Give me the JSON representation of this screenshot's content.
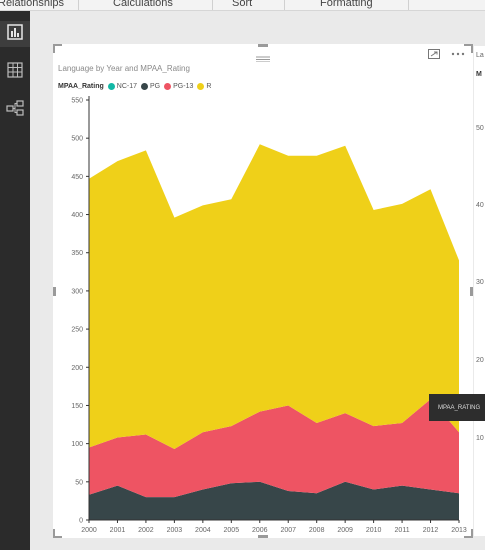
{
  "ribbon": {
    "tabs": [
      "Relationships",
      "Calculations",
      "Sort",
      "Formatting"
    ]
  },
  "sidebar": {
    "items": [
      {
        "name": "report-view",
        "icon": "bar-chart-icon",
        "active": true
      },
      {
        "name": "data-view",
        "icon": "table-icon",
        "active": false
      },
      {
        "name": "relationships-view",
        "icon": "relationship-icon",
        "active": false
      }
    ]
  },
  "visual": {
    "title": "Language by Year and MPAA_Rating",
    "legend_title": "MPAA_Rating",
    "tooltip_label": "MPAA_RATING"
  },
  "second_visual": {
    "title_fragment": "La",
    "legend_fragment": "M",
    "axis_fragments": [
      "50",
      "40",
      "30",
      "20",
      "10"
    ]
  },
  "colors": {
    "NC-17": "#13b8a6",
    "PG": "#374649",
    "PG-13": "#ee5463",
    "R": "#efd019",
    "axis": "#333333"
  },
  "chart_data": {
    "type": "area",
    "stacked": true,
    "title": "Language by Year and MPAA_Rating",
    "legend_title": "MPAA_Rating",
    "legend_position": "top-left",
    "x": [
      "2000",
      "2001",
      "2002",
      "2003",
      "2004",
      "2005",
      "2006",
      "2007",
      "2008",
      "2009",
      "2010",
      "2011",
      "2012",
      "2013"
    ],
    "series": [
      {
        "name": "NC-17",
        "values": [
          0,
          0,
          0,
          0,
          0,
          0,
          0,
          0,
          0,
          0,
          0,
          0,
          0,
          0
        ]
      },
      {
        "name": "PG",
        "values": [
          33,
          45,
          30,
          30,
          40,
          48,
          50,
          38,
          35,
          50,
          40,
          45,
          40,
          35
        ]
      },
      {
        "name": "PG-13",
        "values": [
          62,
          63,
          82,
          63,
          75,
          75,
          92,
          112,
          92,
          90,
          83,
          82,
          118,
          80
        ]
      },
      {
        "name": "R",
        "values": [
          352,
          362,
          372,
          303,
          297,
          297,
          350,
          327,
          350,
          350,
          283,
          287,
          275,
          225
        ]
      }
    ],
    "yticks": [
      0,
      50,
      100,
      150,
      200,
      250,
      300,
      350,
      400,
      450,
      500,
      550
    ],
    "ylim": [
      0,
      550
    ],
    "grid": false
  }
}
